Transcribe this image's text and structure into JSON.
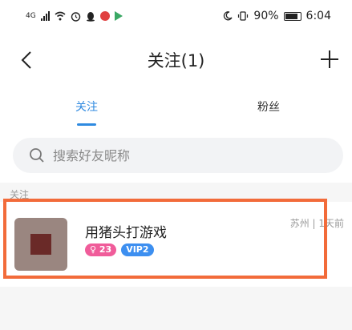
{
  "status_bar": {
    "network": "4G",
    "battery": "90%",
    "time": "6:04"
  },
  "header": {
    "title": "关注(1)"
  },
  "tabs": [
    {
      "label": "关注",
      "active": true
    },
    {
      "label": "粉丝",
      "active": false
    }
  ],
  "search": {
    "placeholder": "搜索好友昵称"
  },
  "section": {
    "label": "关注"
  },
  "users": [
    {
      "name": "用猪头打游戏",
      "level_badge": "23",
      "vip_badge": "VIP2",
      "location_time": "苏州 | 1天前"
    }
  ],
  "colors": {
    "accent": "#2f8ae0",
    "highlight": "#f26b3a",
    "level_badge": "#f05c9a",
    "vip_badge": "#3d8ff0"
  }
}
